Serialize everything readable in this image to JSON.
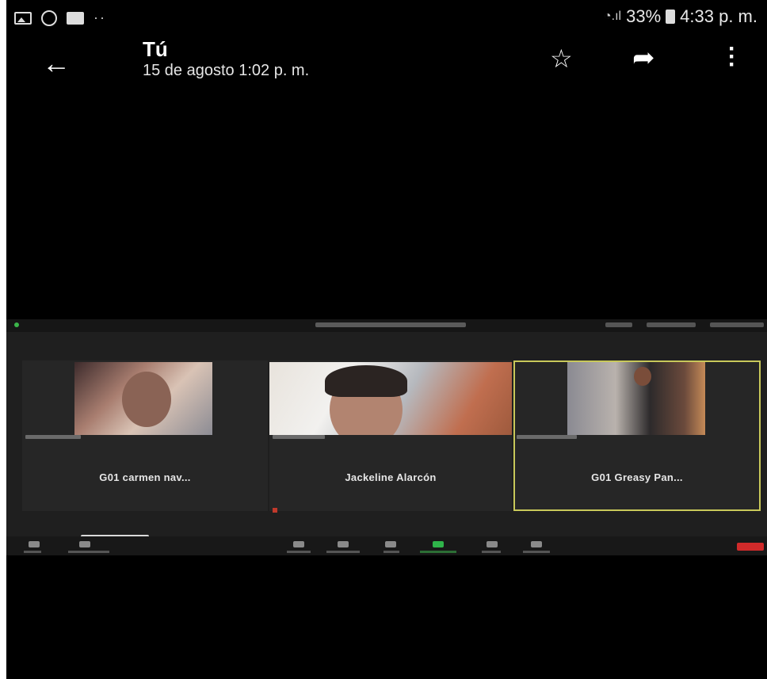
{
  "status_bar": {
    "battery": "33%",
    "time": "4:33 p. m."
  },
  "app_bar": {
    "title": "Tú",
    "subtitle": "15 de agosto 1:02 p. m."
  },
  "zoom": {
    "participants": [
      {
        "name": "G01 carmen nav..."
      },
      {
        "name": "Jackeline Alarcón"
      },
      {
        "name": "G01 Greasy Pan..."
      }
    ]
  }
}
